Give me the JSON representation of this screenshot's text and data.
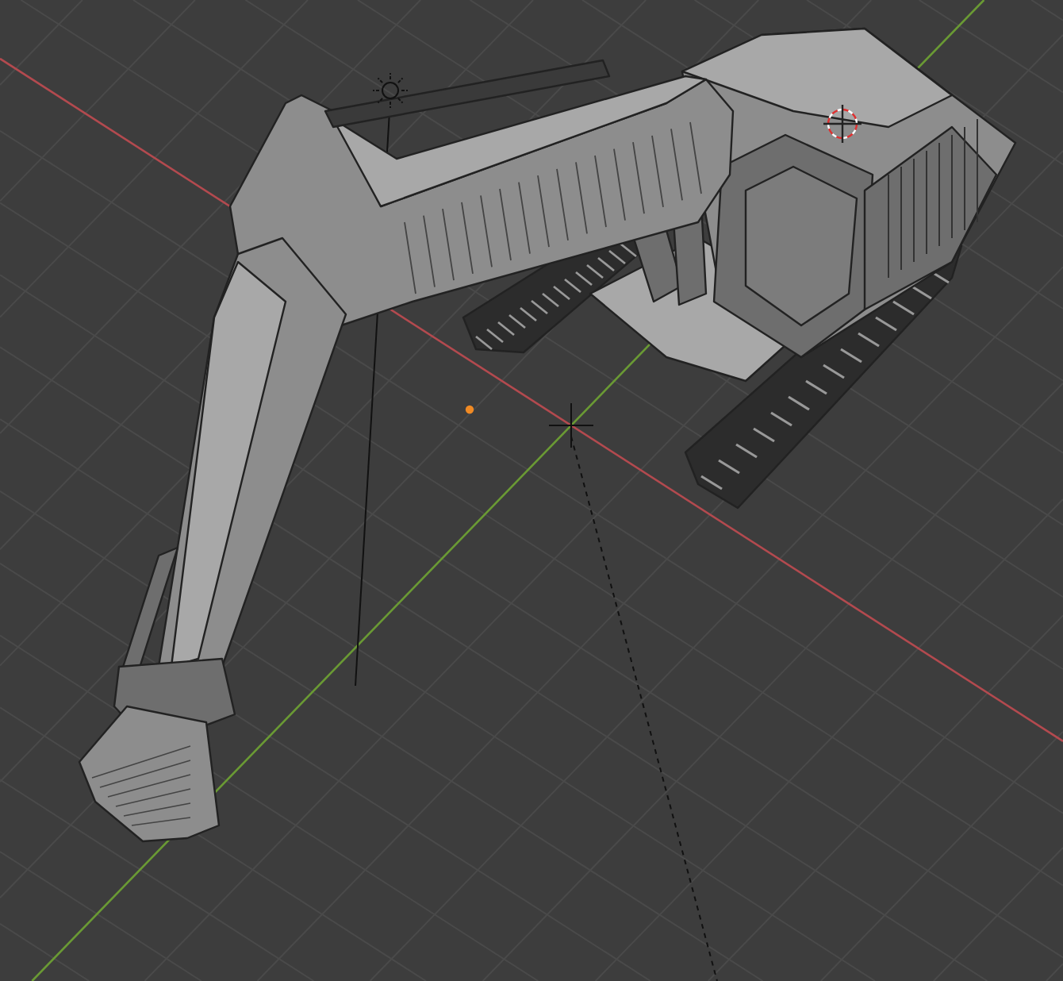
{
  "viewport": {
    "axes": [
      {
        "kind": "x",
        "color": "#b34a4f"
      },
      {
        "kind": "y",
        "color": "#6a9a34"
      }
    ]
  }
}
